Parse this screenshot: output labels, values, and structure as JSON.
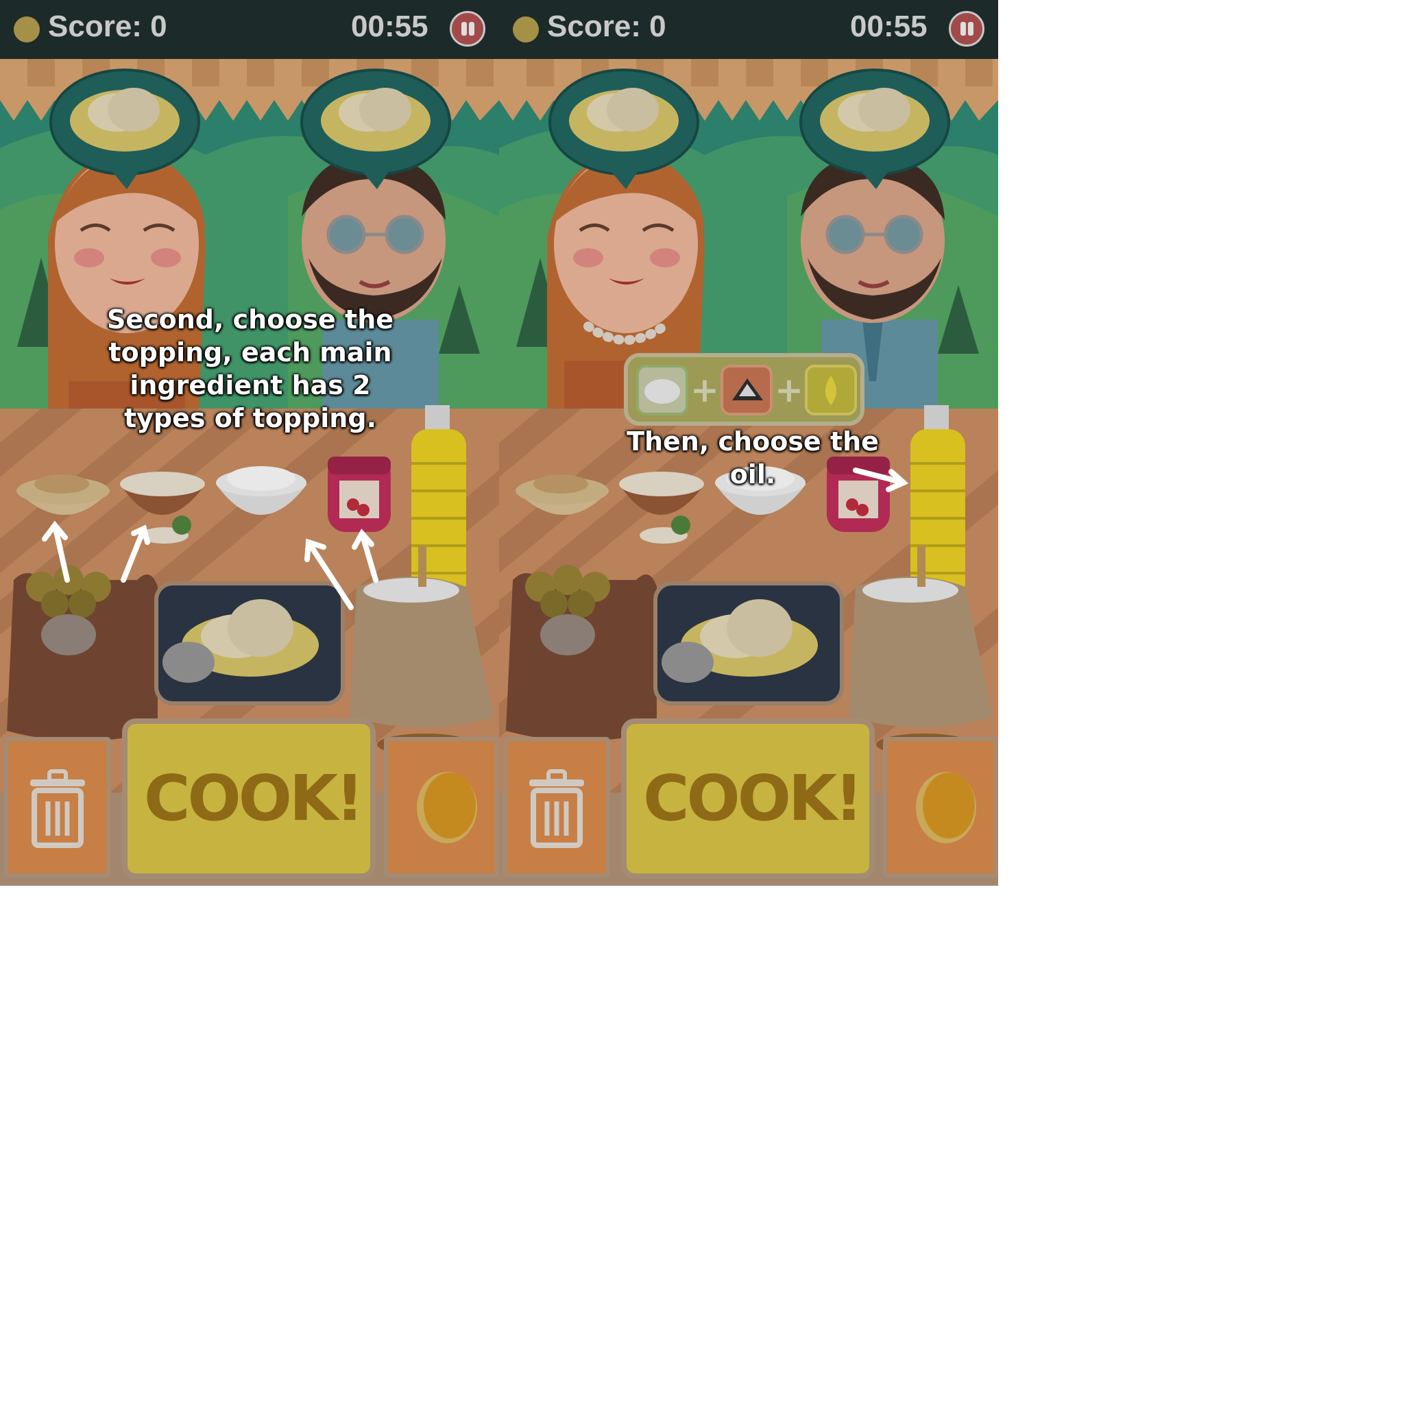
{
  "panels": [
    {
      "hud": {
        "score_label": "Score: 0",
        "timer": "00:55"
      },
      "instruction": "Second, choose the topping, each  main ingredient has 2 types of topping.",
      "cook_label": "COOK!"
    },
    {
      "hud": {
        "score_label": "Score: 0",
        "timer": "00:55"
      },
      "instruction": "Then, choose the oil.",
      "cook_label": "COOK!"
    }
  ],
  "icons": {
    "coin": "coin-icon",
    "pause": "pause-icon",
    "trash": "trash-icon",
    "pancake": "pancake-icon"
  },
  "colors": {
    "hud_bg": "#1c2b29",
    "hud_text": "#c9c9c9",
    "awning": "#c89768",
    "sky_green": "#2d8a73",
    "counter": "#b9825a",
    "cook_button": "#c7b440",
    "side_button": "#c77f45"
  }
}
